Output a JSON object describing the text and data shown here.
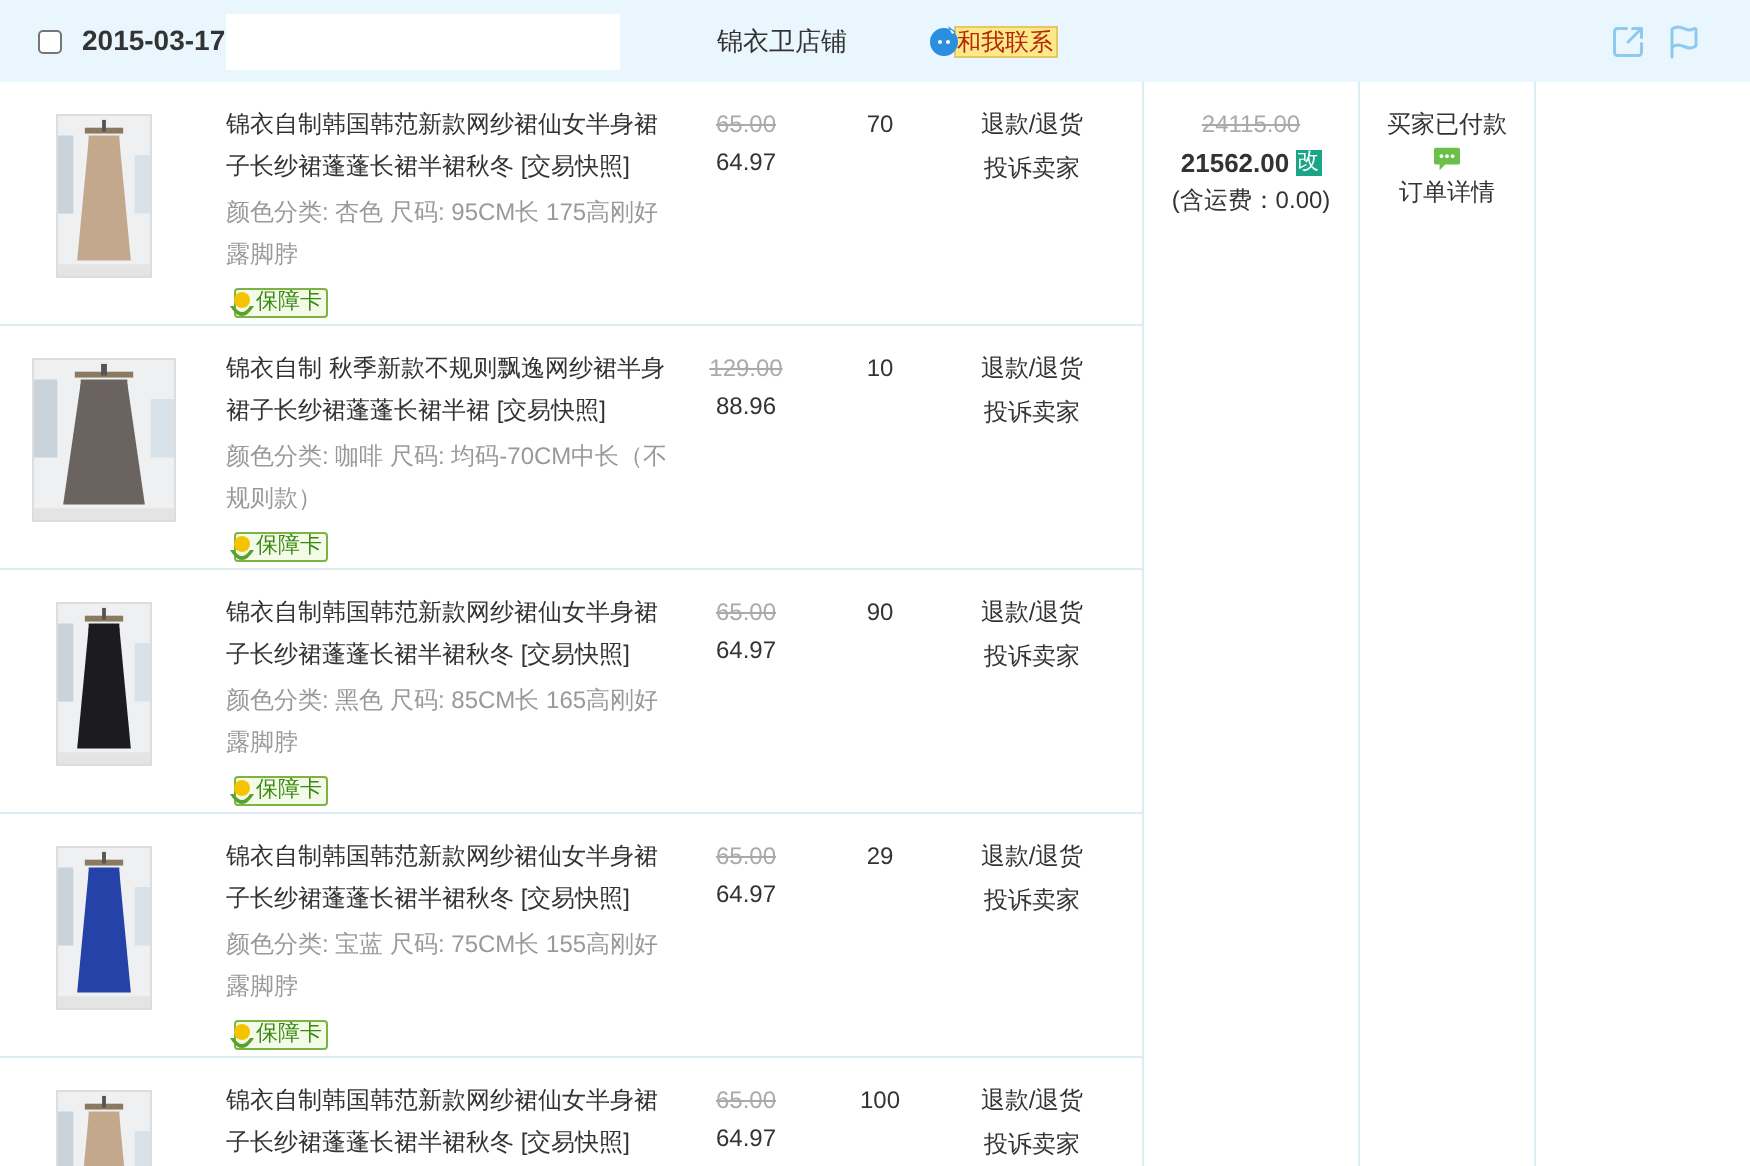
{
  "header": {
    "checked": false,
    "date": "2015-03-17",
    "shop": "锦衣卫店铺",
    "contact": "和我联系"
  },
  "items": [
    {
      "title": "锦衣自制韩国韩范新款网纱裙仙女半身裙子长纱裙蓬蓬长裙半裙秋冬",
      "snapshot": "[交易快照]",
      "sku": "颜色分类: 杏色  尺码: 95CM长 175高刚好露脚脖",
      "badge": "保障卡",
      "original_price": "65.00",
      "price": "64.97",
      "quantity": "70",
      "actions": [
        "退款/退货",
        "投诉卖家"
      ]
    },
    {
      "title": "锦衣自制 秋季新款不规则飘逸网纱裙半身裙子长纱裙蓬蓬长裙半裙",
      "snapshot": "[交易快照]",
      "sku": "颜色分类: 咖啡  尺码: 均码-70CM中长（不规则款）",
      "badge": "保障卡",
      "original_price": "129.00",
      "price": "88.96",
      "quantity": "10",
      "actions": [
        "退款/退货",
        "投诉卖家"
      ]
    },
    {
      "title": "锦衣自制韩国韩范新款网纱裙仙女半身裙子长纱裙蓬蓬长裙半裙秋冬",
      "snapshot": "[交易快照]",
      "sku": "颜色分类: 黑色  尺码: 85CM长 165高刚好露脚脖",
      "badge": "保障卡",
      "original_price": "65.00",
      "price": "64.97",
      "quantity": "90",
      "actions": [
        "退款/退货",
        "投诉卖家"
      ]
    },
    {
      "title": "锦衣自制韩国韩范新款网纱裙仙女半身裙子长纱裙蓬蓬长裙半裙秋冬",
      "snapshot": "[交易快照]",
      "sku": "颜色分类: 宝蓝  尺码: 75CM长 155高刚好露脚脖",
      "badge": "保障卡",
      "original_price": "65.00",
      "price": "64.97",
      "quantity": "29",
      "actions": [
        "退款/退货",
        "投诉卖家"
      ]
    },
    {
      "title": "锦衣自制韩国韩范新款网纱裙仙女半身裙子长纱裙蓬蓬长裙半裙秋冬",
      "snapshot": "[交易快照]",
      "original_price": "65.00",
      "price": "64.97",
      "quantity": "100",
      "actions": [
        "退款/退货",
        "投诉卖家"
      ]
    }
  ],
  "order": {
    "original_total": "24115.00",
    "total": "21562.00",
    "edit": "改",
    "shipping": "(含运费：0.00)",
    "status": "买家已付款",
    "detail": "订单详情"
  }
}
